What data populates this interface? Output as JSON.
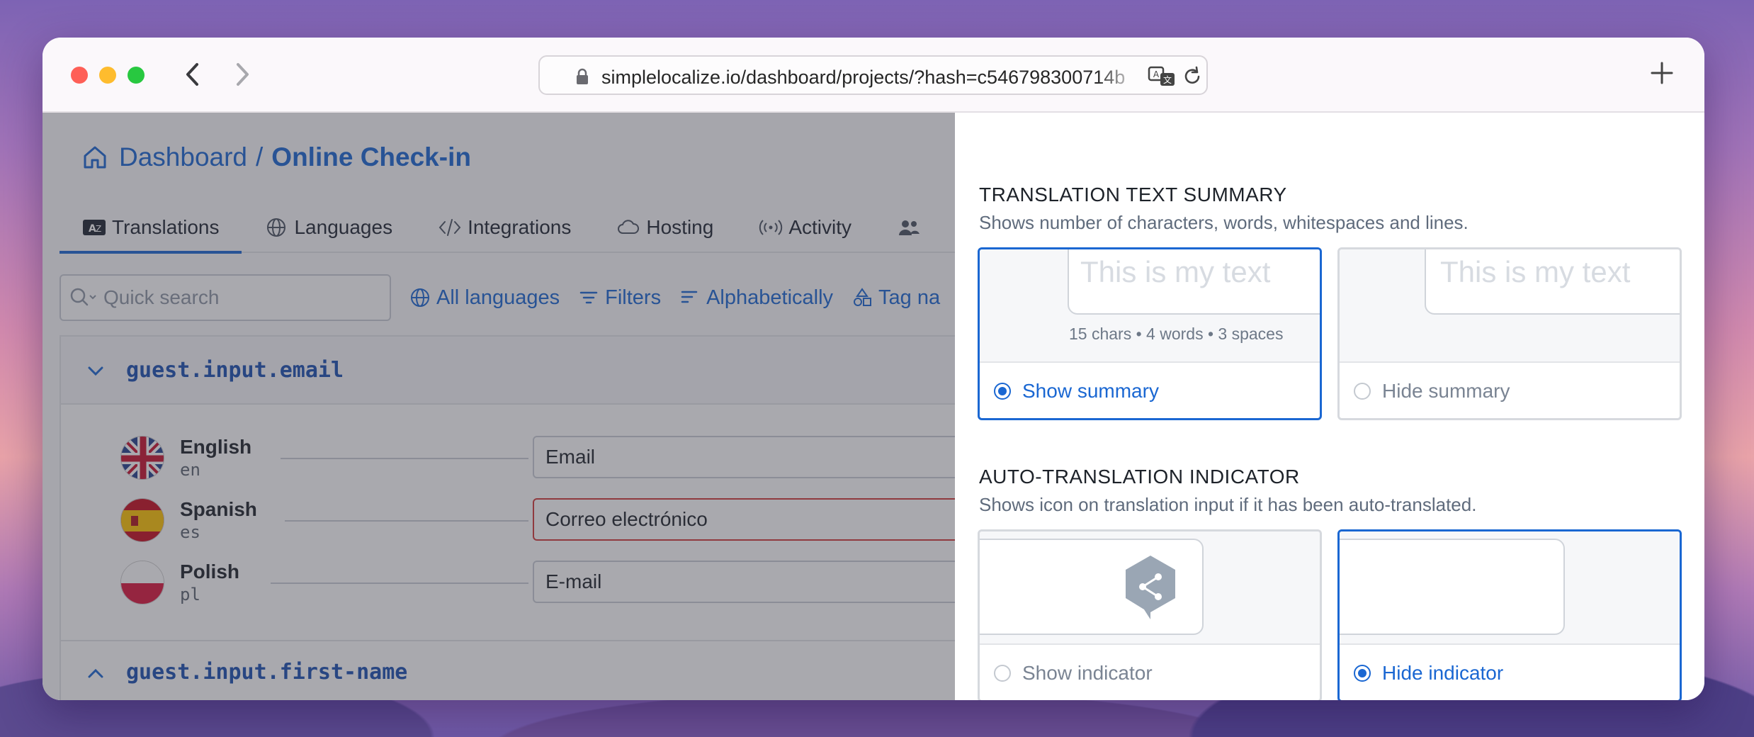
{
  "browser": {
    "url": "simplelocalize.io/dashboard/projects/?hash=c546798300714b"
  },
  "breadcrumb": {
    "root": "Dashboard",
    "separator": "/",
    "current": "Online Check-in"
  },
  "tabs": [
    {
      "label": "Translations",
      "icon": "translate-icon",
      "active": true
    },
    {
      "label": "Languages",
      "icon": "globe-icon"
    },
    {
      "label": "Integrations",
      "icon": "code-icon"
    },
    {
      "label": "Hosting",
      "icon": "cloud-icon"
    },
    {
      "label": "Activity",
      "icon": "broadcast-icon"
    }
  ],
  "toolbar": {
    "search_placeholder": "Quick search",
    "all_languages": "All languages",
    "filters": "Filters",
    "sort": "Alphabetically",
    "tag": "Tag na"
  },
  "keys": [
    {
      "name": "guest.input.email",
      "expanded": true,
      "translations": [
        {
          "language": "English",
          "code": "en",
          "value": "Email"
        },
        {
          "language": "Spanish",
          "code": "es",
          "value": "Correo electrónico"
        },
        {
          "language": "Polish",
          "code": "pl",
          "value": "E-mail"
        }
      ]
    },
    {
      "name": "guest.input.first-name",
      "expanded": false
    }
  ],
  "panel": {
    "summary_section": {
      "title": "TRANSLATION TEXT SUMMARY",
      "description": "Shows number of characters, words, whitespaces and lines.",
      "preview_text": "This is my text",
      "stats": "15 chars • 4 words • 3 spaces",
      "options": [
        {
          "label": "Show summary",
          "selected": true
        },
        {
          "label": "Hide summary",
          "selected": false
        }
      ]
    },
    "indicator_section": {
      "title": "AUTO-TRANSLATION INDICATOR",
      "description": "Shows icon on translation input if it has been auto-translated.",
      "options": [
        {
          "label": "Show indicator",
          "selected": false
        },
        {
          "label": "Hide indicator",
          "selected": true
        }
      ]
    }
  },
  "colors": {
    "accent": "#1a67d2",
    "error": "#d23a3a",
    "deepl_gray": "#9aa6b4"
  }
}
